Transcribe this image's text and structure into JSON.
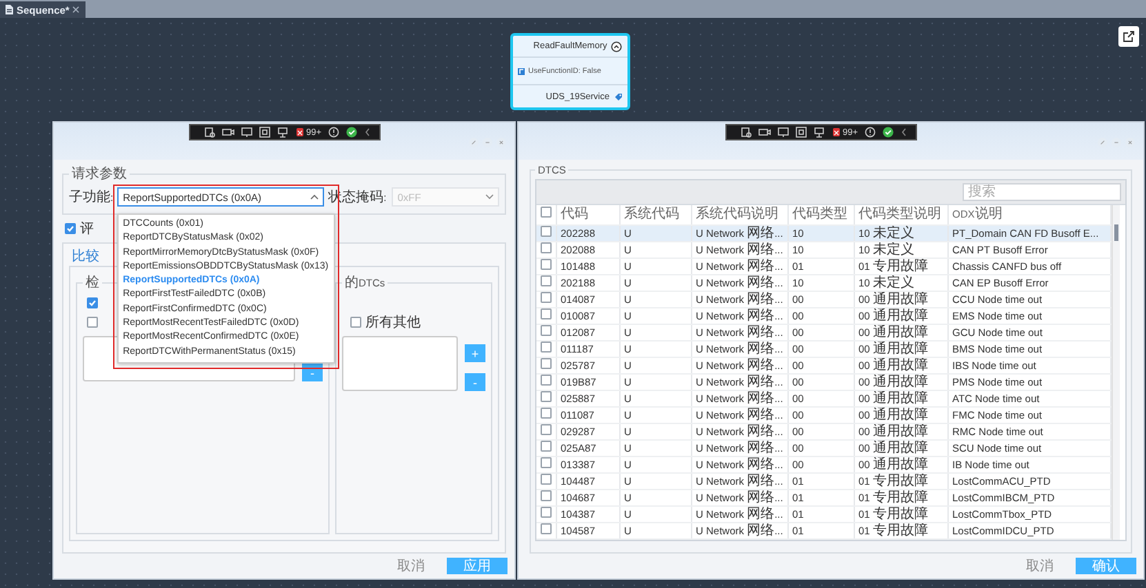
{
  "tab": {
    "title": "Sequence*"
  },
  "node": {
    "title": "ReadFaultMemory",
    "property": "UseFunctionID: False",
    "service": "UDS_19Service"
  },
  "left_dialog": {
    "toolbar": {
      "badge": "99+"
    },
    "request_group": {
      "title": "请求参数",
      "subfunction_label": "子功能:",
      "subfunction_value": "ReportSupportedDTCs (0x0A)",
      "status_mask_label": "状态掩码:",
      "status_mask_value": "0xFF",
      "status_mask_disabled": true
    },
    "dropdown_options": [
      {
        "label": "DTCCounts (0x01)",
        "selected": false
      },
      {
        "label": "ReportDTCByStatusMask (0x02)",
        "selected": false
      },
      {
        "label": "ReportMirrorMemoryDtcByStatusMask (0x0F)",
        "selected": false
      },
      {
        "label": "ReportEmissionsOBDDTCByStatusMask (0x13)",
        "selected": false
      },
      {
        "label": "ReportSupportedDTCs (0x0A)",
        "selected": true
      },
      {
        "label": "ReportFirstTestFailedDTC (0x0B)",
        "selected": false
      },
      {
        "label": "ReportFirstConfirmedDTC (0x0C)",
        "selected": false
      },
      {
        "label": "ReportMostRecentTestFailedDTC (0x0D)",
        "selected": false
      },
      {
        "label": "ReportMostRecentConfirmedDTC (0x0E)",
        "selected": false
      },
      {
        "label": "ReportDTCWithPermanentStatus (0x15)",
        "selected": false
      }
    ],
    "evaluate_checkbox": {
      "label": "评",
      "checked": true
    },
    "compare_tab": {
      "label": "比较"
    },
    "left_group": {
      "title": "检",
      "checkboxes": [
        {
          "checked": true
        },
        {
          "checked": false
        }
      ],
      "remove_button": "-"
    },
    "right_group": {
      "title": "的DTCs",
      "checkbox": {
        "label": "所有其他",
        "checked": false
      },
      "add_button": "+",
      "remove_button": "-"
    },
    "cancel_button": "取消",
    "apply_button": "应用"
  },
  "right_dialog": {
    "toolbar": {
      "badge": "99+"
    },
    "group_title": "DTCS",
    "search": {
      "placeholder": "搜索"
    },
    "all_checked": false,
    "columns": [
      "代码",
      "系统代码",
      "系统代码说明",
      "代码类型",
      "代码类型说明",
      "ODX说明"
    ],
    "rows": [
      {
        "selected": true,
        "checked": false,
        "cells": [
          "202288",
          "U",
          "U Network 网络...",
          "10",
          "10 未定义",
          "PT_Domain CAN FD Busoff E..."
        ]
      },
      {
        "selected": false,
        "checked": false,
        "cells": [
          "202088",
          "U",
          "U Network 网络...",
          "10",
          "10 未定义",
          "CAN PT Busoff Error"
        ]
      },
      {
        "selected": false,
        "checked": false,
        "cells": [
          "101488",
          "U",
          "U Network 网络...",
          "01",
          "01 专用故障",
          "Chassis CANFD bus off"
        ]
      },
      {
        "selected": false,
        "checked": false,
        "cells": [
          "202188",
          "U",
          "U Network 网络...",
          "10",
          "10 未定义",
          "CAN EP Busoff Error"
        ]
      },
      {
        "selected": false,
        "checked": false,
        "cells": [
          "014087",
          "U",
          "U Network 网络...",
          "00",
          "00 通用故障",
          "CCU Node time out"
        ]
      },
      {
        "selected": false,
        "checked": false,
        "cells": [
          "010087",
          "U",
          "U Network 网络...",
          "00",
          "00 通用故障",
          "EMS Node time out"
        ]
      },
      {
        "selected": false,
        "checked": false,
        "cells": [
          "012087",
          "U",
          "U Network 网络...",
          "00",
          "00 通用故障",
          "GCU Node time out"
        ]
      },
      {
        "selected": false,
        "checked": false,
        "cells": [
          "011187",
          "U",
          "U Network 网络...",
          "00",
          "00 通用故障",
          "BMS Node time out"
        ]
      },
      {
        "selected": false,
        "checked": false,
        "cells": [
          "025787",
          "U",
          "U Network 网络...",
          "00",
          "00 通用故障",
          "IBS Node time out"
        ]
      },
      {
        "selected": false,
        "checked": false,
        "cells": [
          "019B87",
          "U",
          "U Network 网络...",
          "00",
          "00 通用故障",
          "PMS Node time out"
        ]
      },
      {
        "selected": false,
        "checked": false,
        "cells": [
          "025887",
          "U",
          "U Network 网络...",
          "00",
          "00 通用故障",
          "ATC Node time out"
        ]
      },
      {
        "selected": false,
        "checked": false,
        "cells": [
          "011087",
          "U",
          "U Network 网络...",
          "00",
          "00 通用故障",
          "FMC Node time out"
        ]
      },
      {
        "selected": false,
        "checked": false,
        "cells": [
          "029287",
          "U",
          "U Network 网络...",
          "00",
          "00 通用故障",
          "RMC Node time out"
        ]
      },
      {
        "selected": false,
        "checked": false,
        "cells": [
          "025A87",
          "U",
          "U Network 网络...",
          "00",
          "00 通用故障",
          "SCU Node time out"
        ]
      },
      {
        "selected": false,
        "checked": false,
        "cells": [
          "013387",
          "U",
          "U Network 网络...",
          "00",
          "00 通用故障",
          "IB Node time out"
        ]
      },
      {
        "selected": false,
        "checked": false,
        "cells": [
          "104487",
          "U",
          "U Network 网络...",
          "01",
          "01 专用故障",
          "LostCommACU_PTD"
        ]
      },
      {
        "selected": false,
        "checked": false,
        "cells": [
          "104687",
          "U",
          "U Network 网络...",
          "01",
          "01 专用故障",
          "LostCommIBCM_PTD"
        ]
      },
      {
        "selected": false,
        "checked": false,
        "cells": [
          "104387",
          "U",
          "U Network 网络...",
          "01",
          "01 专用故障",
          "LostCommTbox_PTD"
        ]
      },
      {
        "selected": false,
        "checked": false,
        "cells": [
          "104587",
          "U",
          "U Network 网络...",
          "01",
          "01 专用故障",
          "LostCommIDCU_PTD"
        ]
      }
    ],
    "cancel_button": "取消",
    "confirm_button": "确认"
  }
}
